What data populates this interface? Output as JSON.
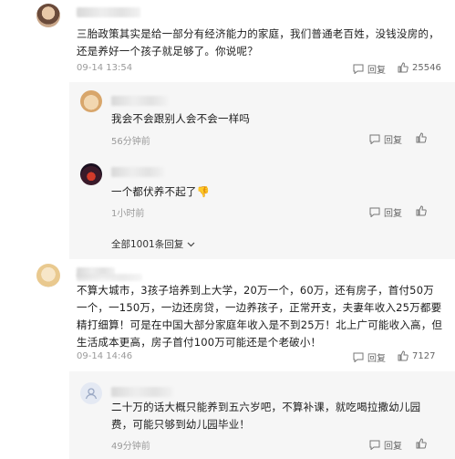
{
  "comments": [
    {
      "text": "三胎政策其实是给一部分有经济能力的家庭，我们普通老百姓，没钱没房的，还是养好一个孩子就足够了。你说呢？",
      "time": "09-14 13:54",
      "reply_label": "回复",
      "likes": "25546",
      "replies": [
        {
          "text": "我会不会跟别人会不会一样吗",
          "time": "56分钟前",
          "reply_label": "回复"
        },
        {
          "text": "一个都伏养不起了👎",
          "time": "1小时前",
          "reply_label": "回复"
        }
      ],
      "expand_label": "全部1001条回复"
    },
    {
      "text": "不算大城市，3孩子培养到上大学，20万一个，60万，还有房子，首付50万一个，一150万，一边还房贷，一边养孩子，正常开支，夫妻年收入25万都要精打细算！可是在中国大部分家庭年收入是不到25万！北上广可能收入高，但生活成本更高，房子首付100万可能还是个老破小！",
      "time": "09-14 14:46",
      "reply_label": "回复",
      "likes": "7127",
      "replies": [
        {
          "text": "二十万的话大概只能养到五六岁吧，不算补课，就吃喝拉撒幼儿园费，可能只够到幼儿园毕业！",
          "time": "49分钟前",
          "reply_label": "回复"
        }
      ]
    }
  ]
}
